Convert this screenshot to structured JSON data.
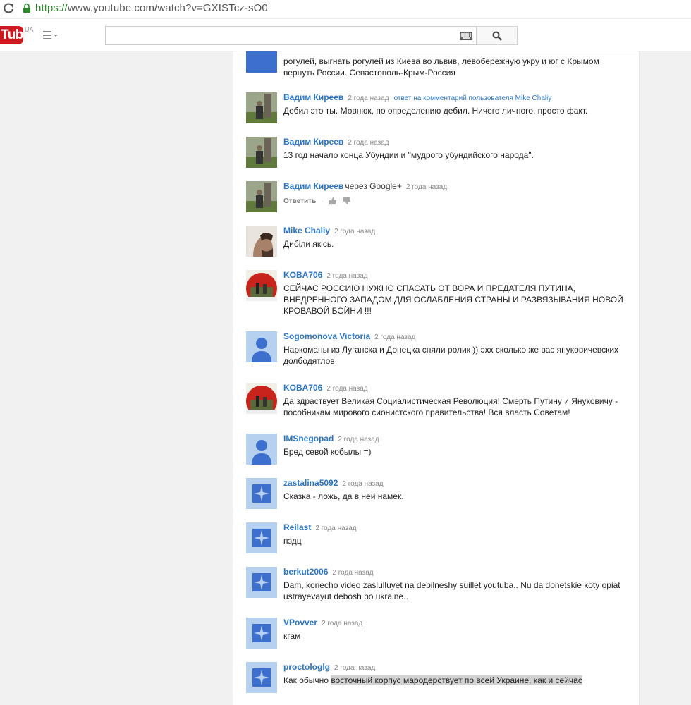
{
  "browser": {
    "url_scheme": "https://",
    "url_rest": "www.youtube.com/watch?v=GXISTcz-sO0"
  },
  "masthead": {
    "logo_text": "Tube",
    "country": "UA",
    "search_placeholder": ""
  },
  "comments": {
    "partial": {
      "lines": "рогулей, выгнать рогулей из Киева во львив, левобережную укру и юг с Крымом вернуть России. Севастополь-Крым-Россия"
    },
    "c1": {
      "author": "Вадим Киреев",
      "time": "2 года назад",
      "reply_to": "ответ на комментарий пользователя Mike Chaliy",
      "text": "Дебил это ты. Мовнюк, по определению дебил. Ничего личного, просто факт."
    },
    "c2": {
      "author": "Вадим Киреев",
      "time": "2 года назад",
      "text": "13 год начало конца Убундии и \"мудрого убундийского народа\"."
    },
    "c3": {
      "author": "Вадим Киреев",
      "via": "через Google+",
      "time": "2 года назад",
      "reply_label": "Ответить"
    },
    "c4": {
      "author": "Mike Chaliy",
      "time": "2 года назад",
      "text": "Дибіли якісь."
    },
    "c5": {
      "author": "KOBA706",
      "time": "2 года назад",
      "text": "СЕЙЧАС РОССИЮ НУЖНО СПАСАТЬ ОТ ВОРА И ПРЕДАТЕЛЯ ПУТИНА, ВНЕДРЕННОГО ЗАПАДОМ ДЛЯ ОСЛАБЛЕНИЯ СТРАНЫ И РАЗВЯЗЫВАНИЯ НОВОЙ КРОВАВОЙ БОЙНИ !!!"
    },
    "c6": {
      "author": "Sogomonova Victoria",
      "time": "2 года назад",
      "text": "Наркоманы из Луганска и Донецка сняли ролик )) эхх сколько же вас януковичевских долбодятлов"
    },
    "c7": {
      "author": "KOBA706",
      "time": "2 года назад",
      "text": "Да здраствует Великая Социалистическая Революция! Смерть Путину и Януковичу - пособникам мирового сионистского правительства! Вся власть Советам!"
    },
    "c8": {
      "author": "IMSnegopad",
      "time": "2 года назад",
      "text": "Бред севой кобылы =)"
    },
    "c9": {
      "author": "zastalina5092",
      "time": "2 года назад",
      "text": "Сказка - ложь, да в ней намек."
    },
    "c10": {
      "author": "Reilast",
      "time": "2 года назад",
      "text": "пздц"
    },
    "c11": {
      "author": "berkut2006",
      "time": "2 года назад",
      "text": "Dam, konecho video zaslulluyet na debilneshy suillet youtuba.. Nu da donetskie koty opiat ustrayevayut debosh po ukraine.."
    },
    "c12": {
      "author": "VPovver",
      "time": "2 года назад",
      "text": "кгам"
    },
    "c13": {
      "author": "proctologlg",
      "time": "2 года назад",
      "text_plain": "Как обычно ",
      "text_highlight": "восточный корпус мародерствует по всей Украине, как и сейчас"
    }
  },
  "colors": {
    "link": "#2a75c5",
    "brand_red": "#cc181e",
    "avatar_blue": "#b6d0f0"
  }
}
